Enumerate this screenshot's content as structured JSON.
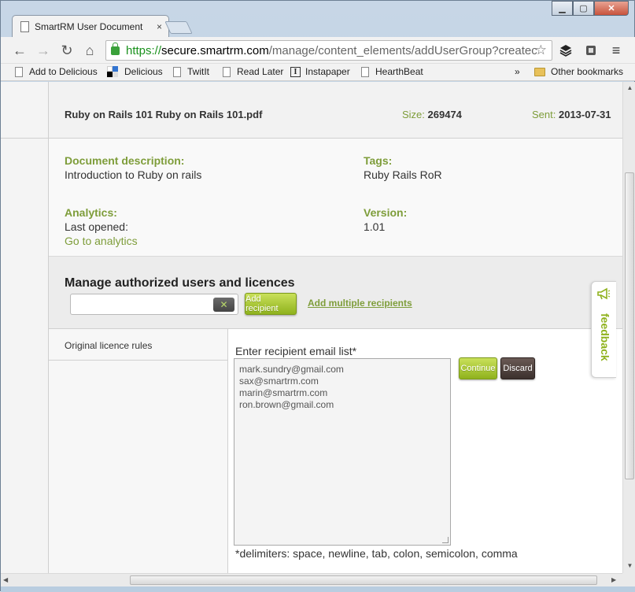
{
  "browser": {
    "tab_title": "SmartRM User Document",
    "tab_close": "×",
    "window_buttons": {
      "minimize": "▁",
      "maximize": "▢",
      "close": "✕"
    },
    "nav": {
      "back": "←",
      "forward": "→",
      "reload": "↻",
      "home": "⌂"
    },
    "url": {
      "scheme": "https://",
      "host": "secure.smartrm.com",
      "path": "/manage/content_elements/addUserGroup?createc"
    },
    "star": "☆",
    "menu": "≡"
  },
  "bookmarks": {
    "items": [
      {
        "label": "Add to Delicious",
        "icon": "page-icon"
      },
      {
        "label": "Delicious",
        "icon": "delicious-icon"
      },
      {
        "label": "TwitIt",
        "icon": "page-icon"
      },
      {
        "label": "Read Later",
        "icon": "page-icon"
      },
      {
        "label": "Instapaper",
        "icon": "instapaper-icon"
      },
      {
        "label": "HearthBeat",
        "icon": "page-icon"
      }
    ],
    "overflow": "»",
    "other": "Other bookmarks"
  },
  "file": {
    "name": "Ruby on Rails 101 Ruby on Rails 101.pdf",
    "size_label": "Size:",
    "size_value": "269474",
    "sent_label": "Sent:",
    "sent_value": "2013-07-31"
  },
  "details": {
    "description_label": "Document description:",
    "description_value": "Introduction to Ruby on rails",
    "tags_label": "Tags:",
    "tags_value": "Ruby Rails RoR",
    "analytics_label": "Analytics:",
    "last_opened": "Last opened:",
    "analytics_link": "Go to analytics",
    "version_label": "Version:",
    "version_value": "1.01"
  },
  "manage": {
    "title": "Manage authorized users and licences",
    "search_value": "",
    "clear": "✕",
    "add_recipient": "Add recipient",
    "add_multiple": "Add multiple recipients"
  },
  "rules": {
    "item": "Original licence rules"
  },
  "recipients": {
    "label": "Enter recipient email list*",
    "emails": [
      "mark.sundry@gmail.com",
      "sax@smartrm.com",
      "marin@smartrm.com",
      "ron.brown@gmail.com"
    ],
    "continue": "Continue",
    "discard": "Discard",
    "delimiters": "*delimiters: space, newline, tab, colon, semicolon, comma"
  },
  "feedback": {
    "label": "feedback"
  },
  "colors": {
    "accent_green": "#7e9d3a",
    "button_green": "#9bbd22",
    "button_dark": "#4a3c38"
  }
}
